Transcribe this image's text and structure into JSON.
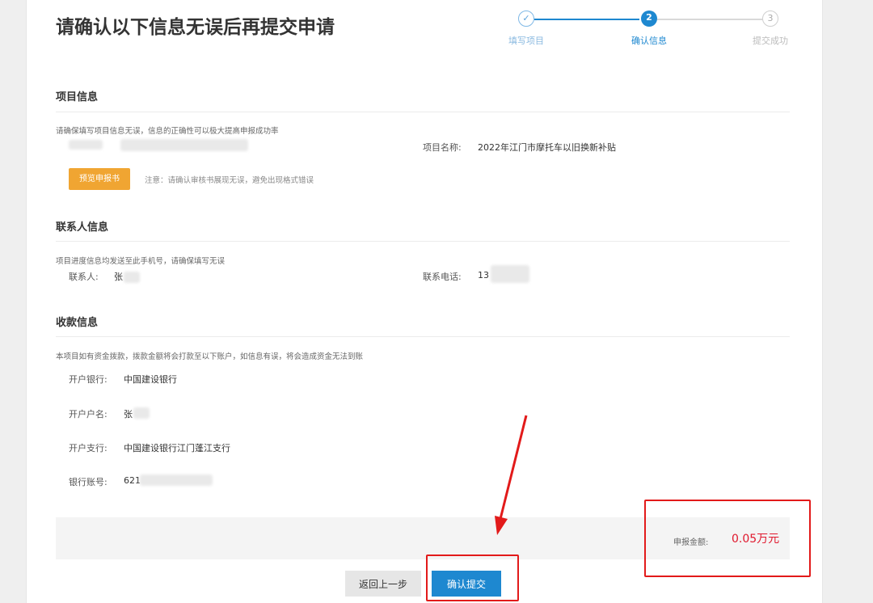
{
  "page": {
    "title": "请确认以下信息无误后再提交申请"
  },
  "stepper": {
    "steps": [
      {
        "number": "✓",
        "label": "填写项目",
        "state": "done"
      },
      {
        "number": "2",
        "label": "确认信息",
        "state": "active"
      },
      {
        "number": "3",
        "label": "提交成功",
        "state": "pending"
      }
    ]
  },
  "project_info": {
    "title": "项目信息",
    "hint": "请确保填写项目信息无误，信息的正确性可以极大提高申报成功率",
    "name_label": "项目名称:",
    "name_value": "2022年江门市摩托车以旧换新补贴",
    "preview_button": "预览申报书",
    "note": "注意：请确认审核书展现无误，避免出现格式错误"
  },
  "contact_info": {
    "title": "联系人信息",
    "hint": "项目进度信息均发送至此手机号，请确保填写无误",
    "person_label": "联系人:",
    "person_value": "张",
    "phone_label": "联系电话:",
    "phone_value": "13"
  },
  "payment_info": {
    "title": "收款信息",
    "hint": "本项目如有资金拨款，拨款金额将会打款至以下账户，如信息有误，将会造成资金无法到账",
    "bank_label": "开户银行:",
    "bank_value": "中国建设银行",
    "account_name_label": "开户户名:",
    "account_name_value": "张",
    "branch_label": "开户支行:",
    "branch_value": "中国建设银行江门蓬江支行",
    "account_no_label": "银行账号:",
    "account_no_value": "621"
  },
  "amount": {
    "label": "申报金额:",
    "value": "0.05万元"
  },
  "actions": {
    "back_label": "返回上一步",
    "submit_label": "确认提交"
  },
  "colors": {
    "accent": "#1e88d0",
    "orange": "#f0a532",
    "amount_red": "#e0182d",
    "annotation_red": "#e21a1a"
  }
}
